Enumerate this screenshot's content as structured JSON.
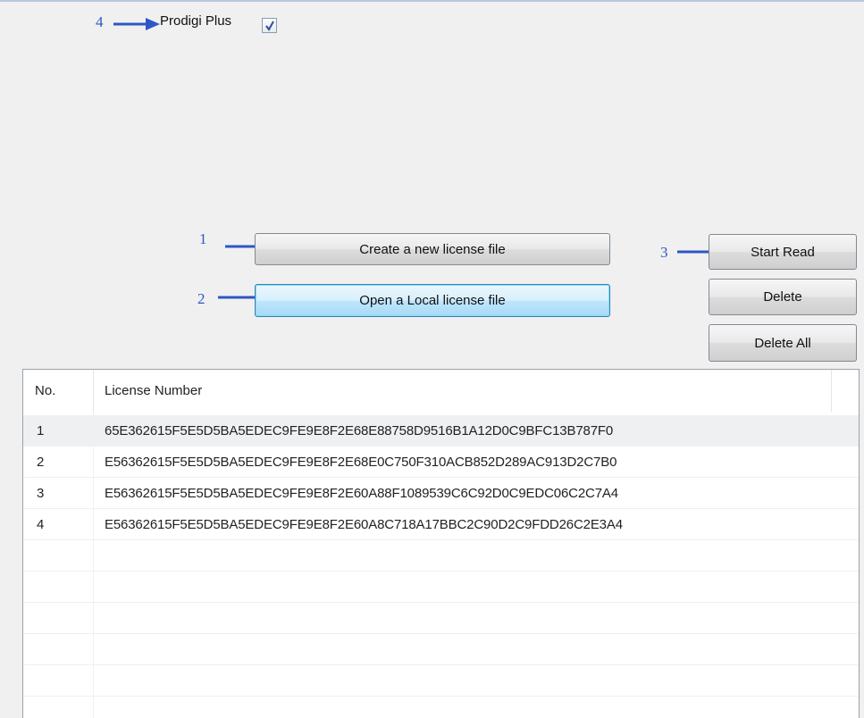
{
  "annotations": {
    "n1": "1",
    "n2": "2",
    "n3": "3",
    "n4": "4"
  },
  "product": {
    "label": "Prodigi Plus",
    "checked": true
  },
  "buttons": {
    "create": "Create a new license file",
    "open": "Open a Local license file",
    "start_read": "Start Read",
    "delete": "Delete",
    "delete_all": "Delete All"
  },
  "table": {
    "headers": {
      "no": "No.",
      "license": "License Number"
    },
    "rows": [
      {
        "no": "1",
        "license": "65E362615F5E5D5BA5EDEC9FE9E8F2E68E88758D9516B1A12D0C9BFC13B787F0"
      },
      {
        "no": "2",
        "license": "E56362615F5E5D5BA5EDEC9FE9E8F2E68E0C750F310ACB852D289AC913D2C7B0"
      },
      {
        "no": "3",
        "license": "E56362615F5E5D5BA5EDEC9FE9E8F2E60A88F1089539C6C92D0C9EDC06C2C7A4"
      },
      {
        "no": "4",
        "license": "E56362615F5E5D5BA5EDEC9FE9E8F2E60A8C718A17BBC2C90D2C9FDD26C2E3A4"
      }
    ],
    "empty_rows": 5
  },
  "colors": {
    "annotation": "#2d57c4",
    "focus_border": "#3c7fb1"
  }
}
